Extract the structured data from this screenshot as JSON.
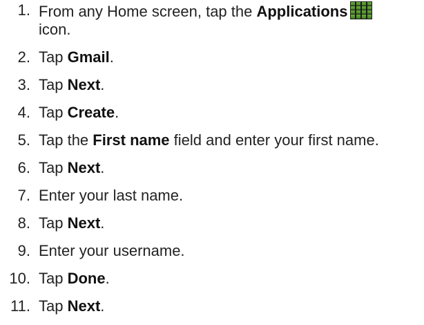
{
  "steps": [
    {
      "num": "1.",
      "pre": "From any Home screen, tap the ",
      "bold": "Applications",
      "post": "",
      "line2": "icon."
    },
    {
      "num": "2.",
      "pre": "Tap ",
      "bold": "Gmail",
      "post": "."
    },
    {
      "num": "3.",
      "pre": "Tap ",
      "bold": "Next",
      "post": "."
    },
    {
      "num": "4.",
      "pre": "Tap ",
      "bold": "Create",
      "post": "."
    },
    {
      "num": "5.",
      "pre": "Tap the ",
      "bold": "First name",
      "post": " field and enter your first name."
    },
    {
      "num": "6.",
      "pre": "Tap ",
      "bold": "Next",
      "post": "."
    },
    {
      "num": "7.",
      "pre": "Enter your last name.",
      "bold": "",
      "post": ""
    },
    {
      "num": "8.",
      "pre": "Tap ",
      "bold": "Next",
      "post": "."
    },
    {
      "num": "9.",
      "pre": "Enter your username.",
      "bold": "",
      "post": ""
    },
    {
      "num": "10.",
      "pre": "Tap ",
      "bold": "Done",
      "post": "."
    },
    {
      "num": "11.",
      "pre": "Tap ",
      "bold": "Next",
      "post": "."
    }
  ],
  "icons": {
    "applications": "applications-grid-icon"
  },
  "colors": {
    "text": "#222222",
    "icon_green": "#4f8b2a",
    "icon_dark": "#1a1a1a"
  }
}
